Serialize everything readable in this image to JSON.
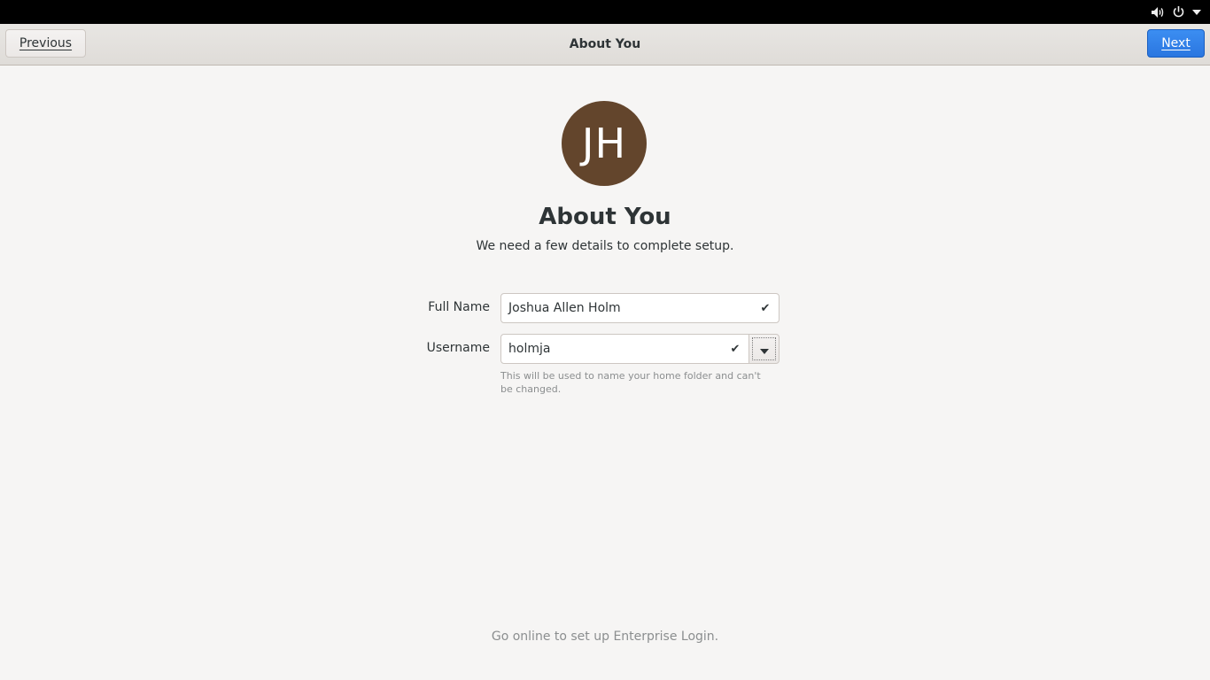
{
  "system": {
    "icons": [
      "volume-icon",
      "power-icon",
      "dropdown-arrow-icon"
    ]
  },
  "header": {
    "title": "About You",
    "previous_label": "Previous",
    "next_label": "Next",
    "next_color": "#2a76e0"
  },
  "avatar": {
    "initials": "JH",
    "color": "#63452c"
  },
  "main": {
    "title": "About You",
    "subtitle": "We need a few details to complete setup."
  },
  "form": {
    "fullname_label": "Full Name",
    "fullname_value": "Joshua Allen Holm",
    "username_label": "Username",
    "username_value": "holmja",
    "username_hint": "This will be used to name your home folder and can't be changed."
  },
  "footer": {
    "note": "Go online to set up Enterprise Login."
  }
}
